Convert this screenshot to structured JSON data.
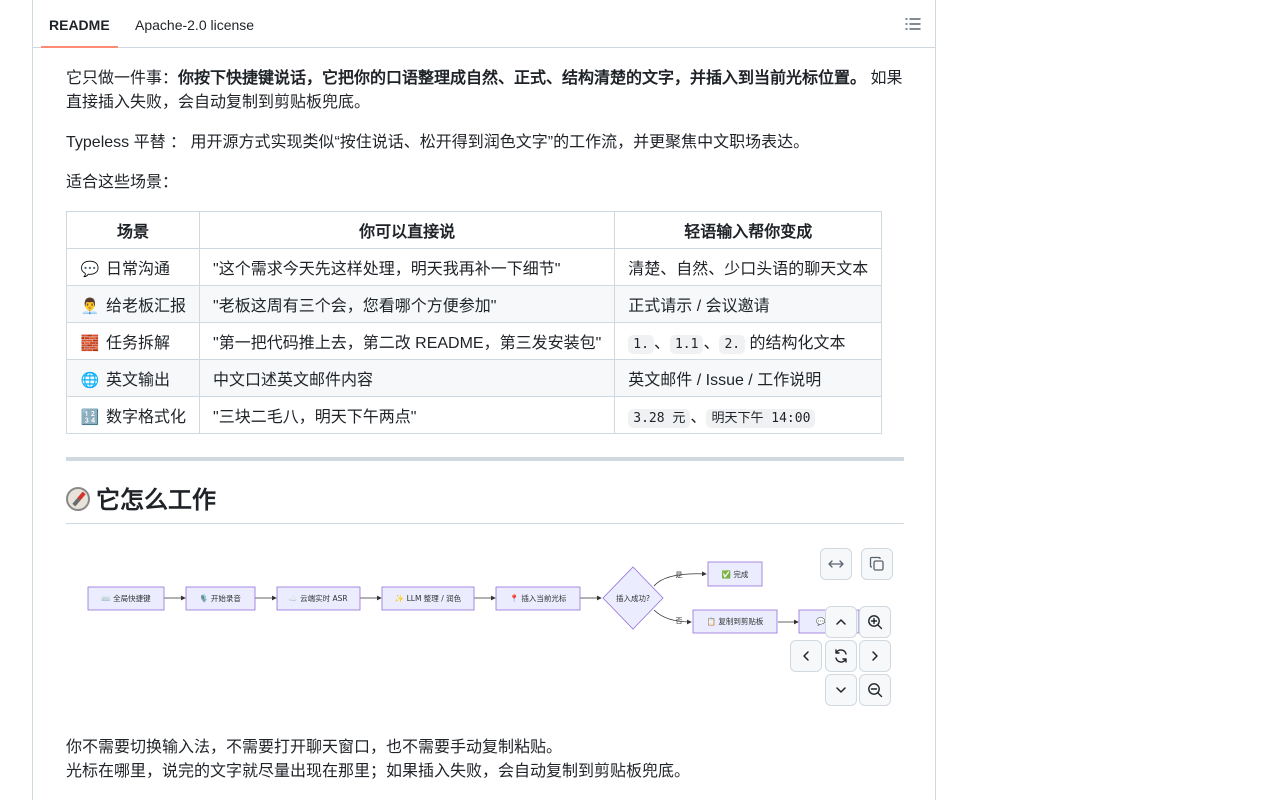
{
  "tabs": {
    "readme": "README",
    "license": "Apache-2.0 license"
  },
  "intro": {
    "prefix": "它只做一件事：",
    "bold": "你按下快捷键说话，它把你的口语整理成自然、正式、结构清楚的文字，并插入到当前光标位置。",
    "suffix": " 如果",
    "line2": "直接插入失败，会自动复制到剪贴板兜底。"
  },
  "typeless_line": "Typeless 平替 ： 用开源方式实现类似“按住说话、松开得到润色文字”的工作流，并更聚焦中文职场表达。",
  "scenes_label": "适合这些场景：",
  "table": {
    "headers": [
      "场景",
      "你可以直接说",
      "轻语输入帮你变成"
    ],
    "rows": [
      {
        "emoji": "💬",
        "scene": "日常沟通",
        "say": "\"这个需求今天先这样处理，明天我再补一下细节\"",
        "result": "清楚、自然、少口头语的聊天文本"
      },
      {
        "emoji": "👨‍💼",
        "scene": "给老板汇报",
        "say": "\"老板这周有三个会，您看哪个方便参加\"",
        "result": "正式请示 / 会议邀请"
      },
      {
        "emoji": "🧱",
        "scene": "任务拆解",
        "say": "\"第一把代码推上去，第二改 README，第三发安装包\"",
        "result_codes": [
          "1.",
          "1.1",
          "2."
        ],
        "result_sep": "、",
        "result_tail": " 的结构化文本"
      },
      {
        "emoji": "🌐",
        "scene": "英文输出",
        "say": "中文口述英文邮件内容",
        "result": "英文邮件 / Issue / 工作说明"
      },
      {
        "emoji": "🔢",
        "scene": "数字格式化",
        "say": "\"三块二毛八，明天下午两点\"",
        "result_codes": [
          "3.28 元",
          "明天下午 14:00"
        ],
        "result_sep": "、"
      }
    ]
  },
  "section_title": "它怎么工作",
  "flowchart": {
    "nodes": [
      "⌨️ 全局快捷键",
      "🎙️ 开始录音",
      "☁️ 云端实时 ASR",
      "✨ LLM 整理 / 润色",
      "📍 插入当前光标",
      "插入成功?",
      "✅ 完成",
      "📋 复制到剪贴板",
      "💬 "
    ],
    "edge_yes": "是",
    "edge_no": "否"
  },
  "outro": {
    "line1": "你不需要切换输入法，不需要打开聊天窗口，也不需要手动复制粘贴。",
    "line2": "光标在哪里，说完的文字就尽量出现在那里；如果插入失败，会自动复制到剪贴板兜底。"
  },
  "colors": {
    "tab_underline": "#fd8c73",
    "node_fill": "#ececff",
    "node_stroke": "#9370db",
    "border": "#d1d9e0"
  }
}
